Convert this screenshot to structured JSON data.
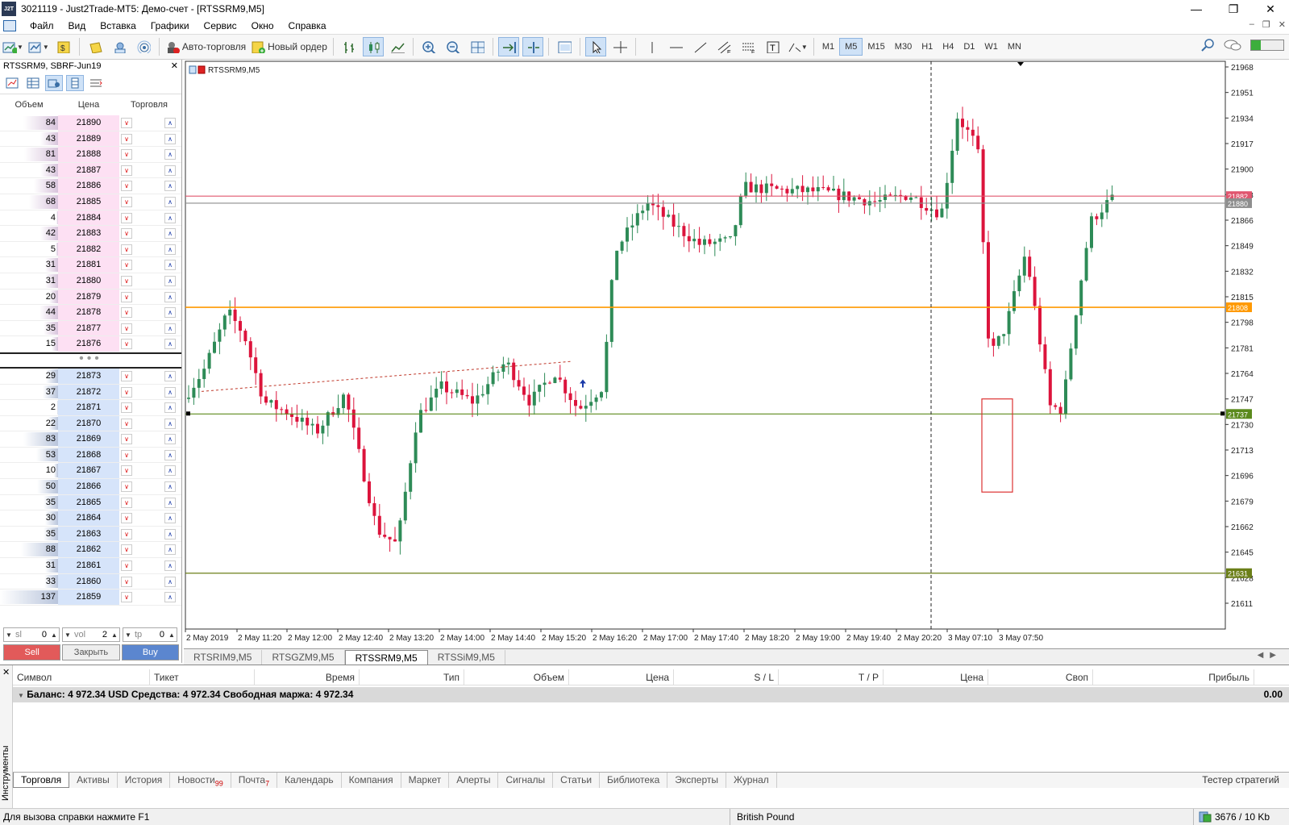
{
  "window": {
    "logo_text": "J2T",
    "title": "3021119 - Just2Trade-MT5: Демо-счет - [RTSSRM9,M5]"
  },
  "menu": [
    "Файл",
    "Вид",
    "Вставка",
    "Графики",
    "Сервис",
    "Окно",
    "Справка"
  ],
  "toolbar": {
    "auto_trading": "Авто-торговля",
    "new_order": "Новый ордер",
    "timeframes": [
      "M1",
      "M5",
      "M15",
      "M30",
      "H1",
      "H4",
      "D1",
      "W1",
      "MN"
    ],
    "active_timeframe": "M5"
  },
  "dom": {
    "header": "RTSSRM9, SBRF-Jun19",
    "columns": {
      "volume": "Объем",
      "price": "Цена",
      "trade": "Торговля"
    },
    "asks": [
      {
        "v": "84",
        "p": "21890",
        "w": 0.6
      },
      {
        "v": "43",
        "p": "21889",
        "w": 0.3
      },
      {
        "v": "81",
        "p": "21888",
        "w": 0.58
      },
      {
        "v": "43",
        "p": "21887",
        "w": 0.3
      },
      {
        "v": "58",
        "p": "21886",
        "w": 0.42
      },
      {
        "v": "68",
        "p": "21885",
        "w": 0.5
      },
      {
        "v": "4",
        "p": "21884",
        "w": 0.03
      },
      {
        "v": "42",
        "p": "21883",
        "w": 0.3
      },
      {
        "v": "5",
        "p": "21882",
        "w": 0.04
      },
      {
        "v": "31",
        "p": "21881",
        "w": 0.22
      },
      {
        "v": "31",
        "p": "21880",
        "w": 0.22
      },
      {
        "v": "20",
        "p": "21879",
        "w": 0.15
      },
      {
        "v": "44",
        "p": "21878",
        "w": 0.32
      },
      {
        "v": "35",
        "p": "21877",
        "w": 0.25
      },
      {
        "v": "15",
        "p": "21876",
        "w": 0.11
      }
    ],
    "bids": [
      {
        "v": "29",
        "p": "21873",
        "w": 0.21
      },
      {
        "v": "37",
        "p": "21872",
        "w": 0.27
      },
      {
        "v": "2",
        "p": "21871",
        "w": 0.02
      },
      {
        "v": "22",
        "p": "21870",
        "w": 0.16
      },
      {
        "v": "83",
        "p": "21869",
        "w": 0.6
      },
      {
        "v": "53",
        "p": "21868",
        "w": 0.38
      },
      {
        "v": "10",
        "p": "21867",
        "w": 0.07
      },
      {
        "v": "50",
        "p": "21866",
        "w": 0.36
      },
      {
        "v": "35",
        "p": "21865",
        "w": 0.25
      },
      {
        "v": "30",
        "p": "21864",
        "w": 0.22
      },
      {
        "v": "35",
        "p": "21863",
        "w": 0.25
      },
      {
        "v": "88",
        "p": "21862",
        "w": 0.64
      },
      {
        "v": "31",
        "p": "21861",
        "w": 0.22
      },
      {
        "v": "33",
        "p": "21860",
        "w": 0.24
      },
      {
        "v": "137",
        "p": "21859",
        "w": 1.0
      }
    ],
    "sl_label": "sl",
    "sl_value": "0",
    "vol_label": "vol",
    "vol_value": "2",
    "tp_label": "tp",
    "tp_value": "0",
    "sell": "Sell",
    "close": "Закрыть",
    "buy": "Buy"
  },
  "chart": {
    "symbol_label": "RTSSRM9,M5",
    "price_levels": [
      "21968",
      "21951",
      "21934",
      "21917",
      "21900",
      "21883",
      "21866",
      "21849",
      "21832",
      "21815",
      "21798",
      "21781",
      "21764",
      "21747",
      "21730",
      "21713",
      "21696",
      "21679",
      "21662",
      "21645",
      "21628",
      "21611"
    ],
    "time_labels": [
      "2 May 2019",
      "2 May 11:20",
      "2 May 12:00",
      "2 May 12:40",
      "2 May 13:20",
      "2 May 14:00",
      "2 May 14:40",
      "2 May 15:20",
      "2 May 16:20",
      "2 May 17:00",
      "2 May 17:40",
      "2 May 18:20",
      "2 May 19:00",
      "2 May 19:40",
      "2 May 20:20",
      "3 May 07:10",
      "3 May 07:50"
    ],
    "hlines": [
      {
        "price": "21882",
        "color": "#e0566f"
      },
      {
        "price": "21880",
        "color": "#8e8e8e"
      },
      {
        "price": "21808",
        "color": "#ff9900"
      },
      {
        "price": "21737",
        "color": "#5b8a1c"
      },
      {
        "price": "21631",
        "color": "#6b7f18"
      }
    ],
    "bull_color": "#2e8b57",
    "bear_color": "#dc143c"
  },
  "chart_tabs": [
    "RTSRIM9,M5",
    "RTSGZM9,M5",
    "RTSSRM9,M5",
    "RTSSiM9,M5"
  ],
  "active_chart_tab": "RTSSRM9,M5",
  "toolbox": {
    "side_label": "Инструменты",
    "columns": [
      "Символ",
      "Тикет",
      "Время",
      "Тип",
      "Объем",
      "Цена",
      "S / L",
      "T / P",
      "Цена",
      "Своп",
      "Прибыль"
    ],
    "balance_text": "Баланс: 4 972.34 USD  Средства: 4 972.34  Свободная маржа: 4 972.34",
    "profit": "0.00",
    "tabs": [
      {
        "label": "Торговля",
        "badge": ""
      },
      {
        "label": "Активы",
        "badge": ""
      },
      {
        "label": "История",
        "badge": ""
      },
      {
        "label": "Новости",
        "badge": "99"
      },
      {
        "label": "Почта",
        "badge": "7"
      },
      {
        "label": "Календарь",
        "badge": ""
      },
      {
        "label": "Компания",
        "badge": ""
      },
      {
        "label": "Маркет",
        "badge": ""
      },
      {
        "label": "Алерты",
        "badge": ""
      },
      {
        "label": "Сигналы",
        "badge": ""
      },
      {
        "label": "Статьи",
        "badge": ""
      },
      {
        "label": "Библиотека",
        "badge": ""
      },
      {
        "label": "Эксперты",
        "badge": ""
      },
      {
        "label": "Журнал",
        "badge": ""
      }
    ],
    "tester": "Тестер стратегий"
  },
  "status": {
    "help": "Для вызова справки нажмите F1",
    "profile": "British Pound",
    "traffic": "3676 / 10 Kb"
  }
}
